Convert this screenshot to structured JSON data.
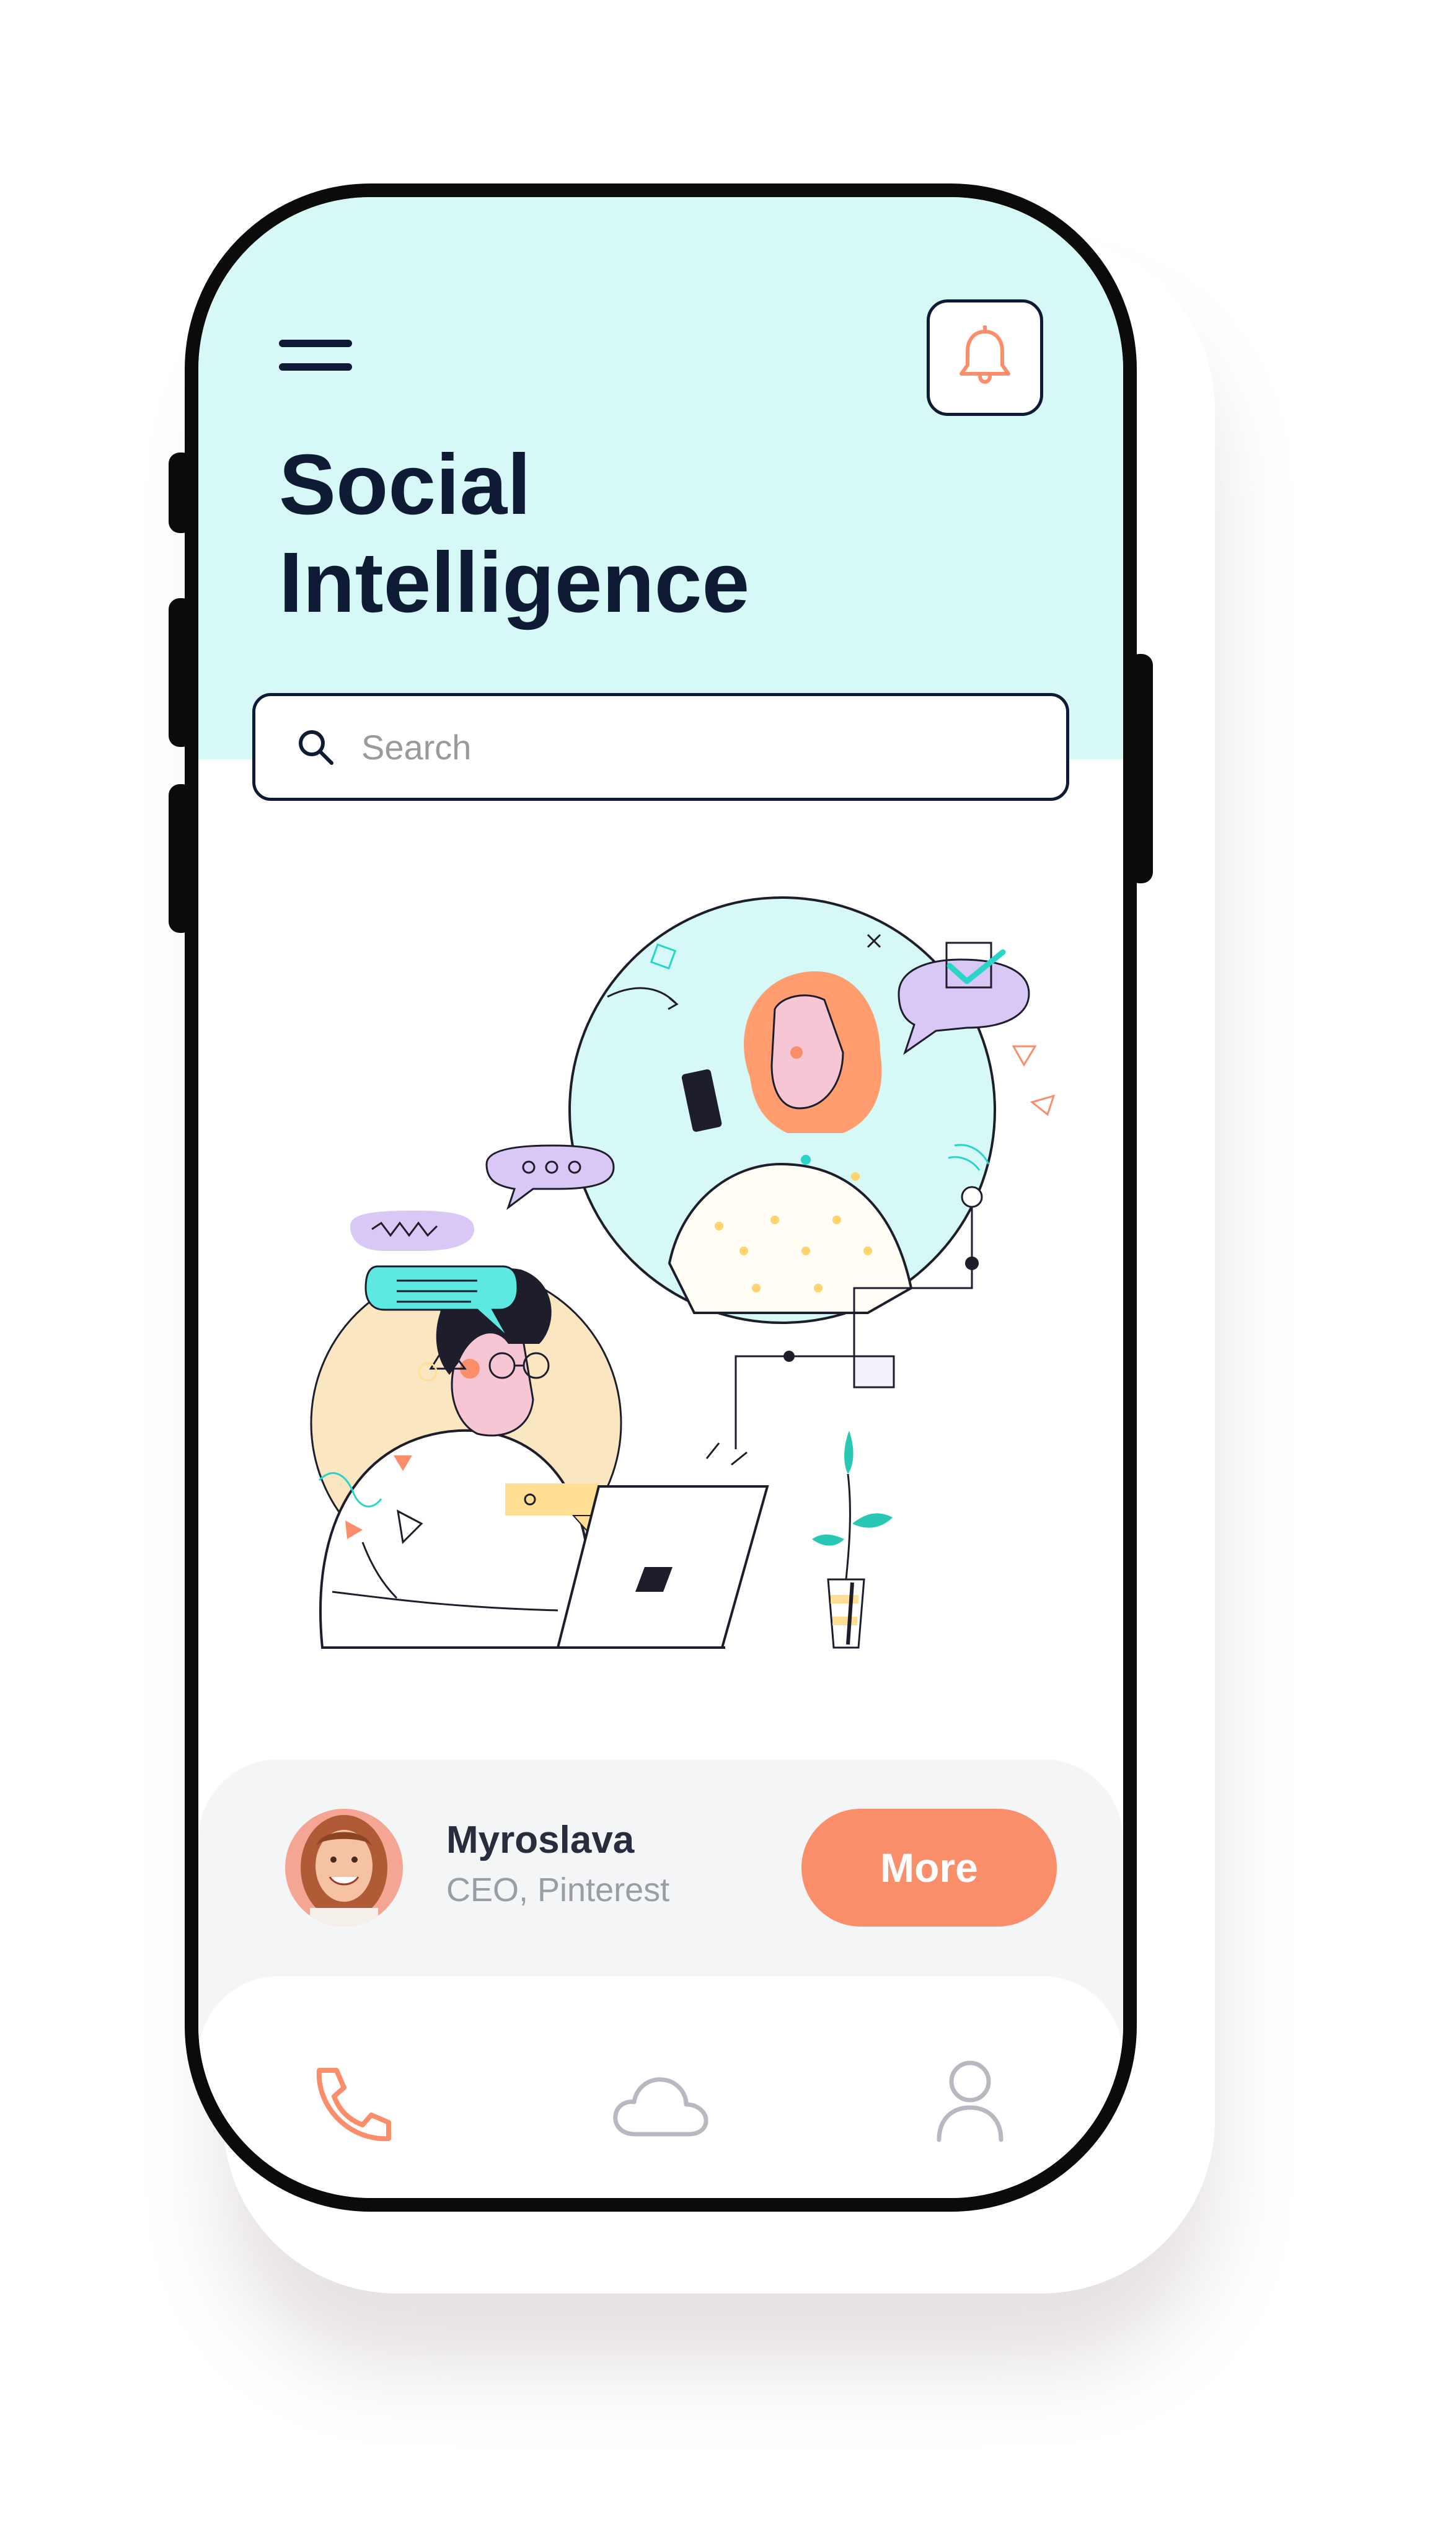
{
  "header": {
    "title_line1": "Social",
    "title_line2": "Intelligence"
  },
  "search": {
    "placeholder": "Search"
  },
  "profile": {
    "name": "Myroslava",
    "role": "CEO, Pinterest",
    "more_label": "More"
  },
  "nav": {
    "items": [
      {
        "icon": "phone-icon",
        "active": true
      },
      {
        "icon": "cloud-icon",
        "active": false
      },
      {
        "icon": "user-icon",
        "active": false
      }
    ]
  },
  "colors": {
    "hero_background": "#d6f8f7",
    "text_dark": "#0f1b35",
    "accent_orange": "#fb8e6a",
    "purple": "#d9c7f6",
    "teal": "#5ee8e2",
    "yellow": "#ffdf94",
    "inactive_icon": "#b8b8c0"
  }
}
